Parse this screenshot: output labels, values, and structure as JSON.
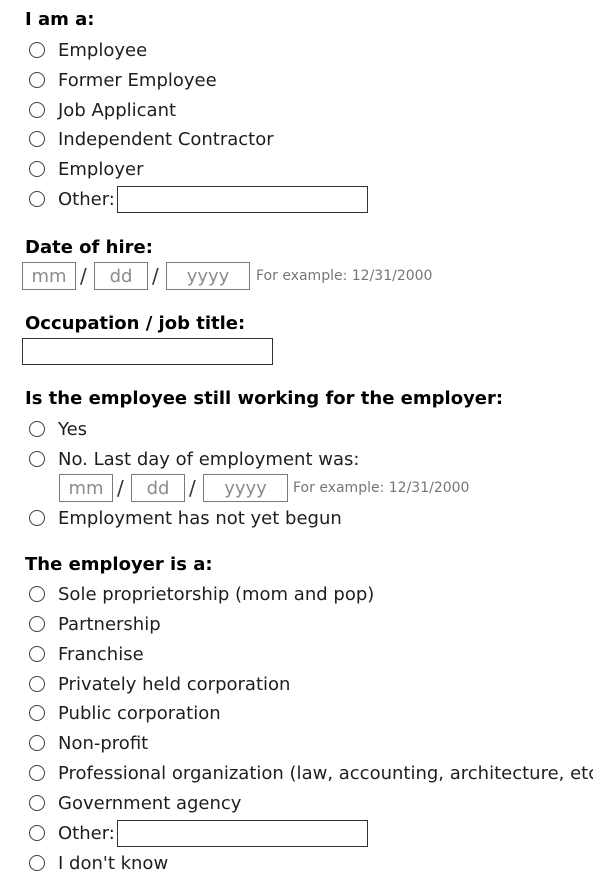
{
  "iam": {
    "heading": "I am a:",
    "options": [
      "Employee",
      "Former Employee",
      "Job Applicant",
      "Independent Contractor",
      "Employer",
      "Other:"
    ],
    "other_value": ""
  },
  "hire": {
    "heading": "Date of hire:",
    "mm_placeholder": "mm",
    "dd_placeholder": "dd",
    "yyyy_placeholder": "yyyy",
    "separator": "/",
    "example": "For example: 12/31/2000"
  },
  "occupation": {
    "heading": "Occupation / job title:",
    "value": ""
  },
  "still_working": {
    "heading": "Is the employee still working for the employer:",
    "options": [
      "Yes",
      "No. Last day of employment was:",
      "Employment has not yet begun"
    ],
    "last_day": {
      "mm_placeholder": "mm",
      "dd_placeholder": "dd",
      "yyyy_placeholder": "yyyy",
      "separator": "/",
      "example": "For example: 12/31/2000"
    }
  },
  "employer_type": {
    "heading": "The employer is a:",
    "options": [
      "Sole proprietorship (mom and pop)",
      "Partnership",
      "Franchise",
      "Privately held corporation",
      "Public corporation",
      "Non-profit",
      "Professional organization (law, accounting, architecture, etc.)",
      "Government agency",
      "Other:",
      "I don't know"
    ],
    "other_value": ""
  }
}
